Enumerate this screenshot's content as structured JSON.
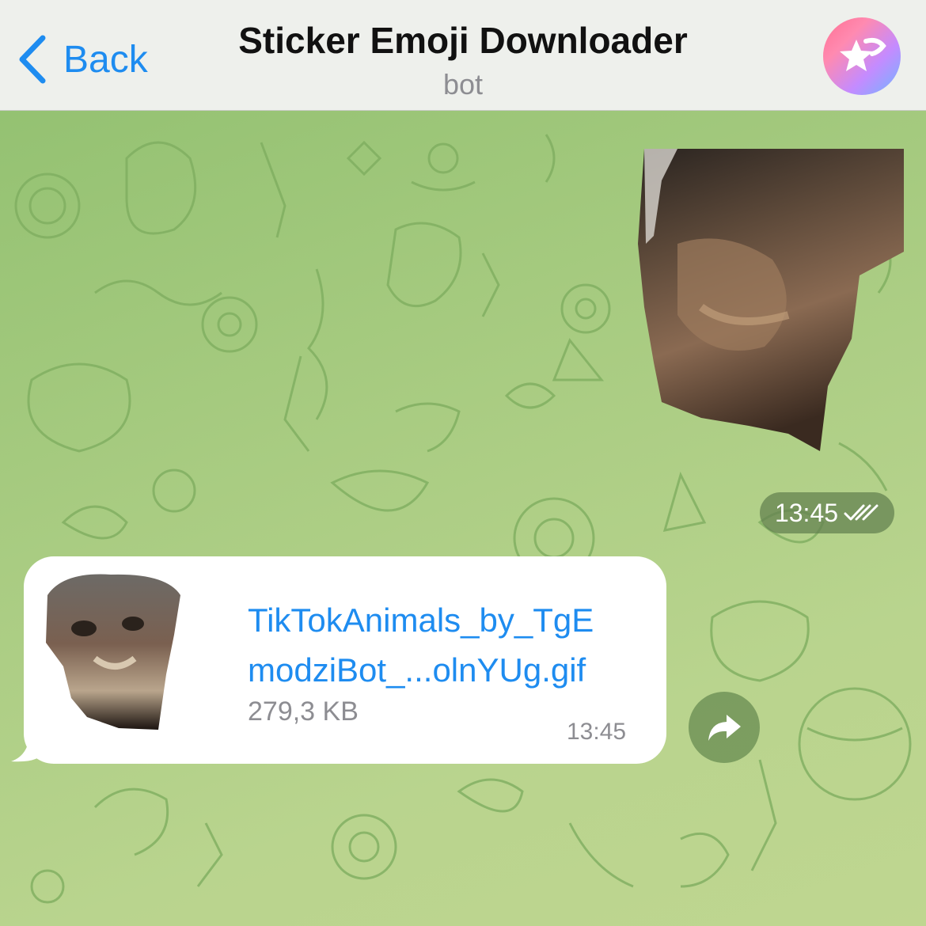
{
  "header": {
    "back_label": "Back",
    "title": "Sticker Emoji Downloader",
    "subtitle": "bot",
    "avatar_icon": "star-icon"
  },
  "messages": {
    "sticker": {
      "time": "13:45",
      "status_icon": "double-check-icon"
    },
    "file": {
      "filename_line1": "TikTokAnimals_by_TgE",
      "filename_line2": "modziBot_...olnYUg.gif",
      "size": "279,3 KB",
      "time": "13:45"
    }
  },
  "actions": {
    "share_icon": "share-arrow-icon"
  },
  "colors": {
    "accent": "#1e8cf0",
    "header_bg": "#eef0ec",
    "chat_bg": "#a9cc82",
    "bubble_bg": "#ffffff",
    "meta_text": "#8d8d92"
  }
}
